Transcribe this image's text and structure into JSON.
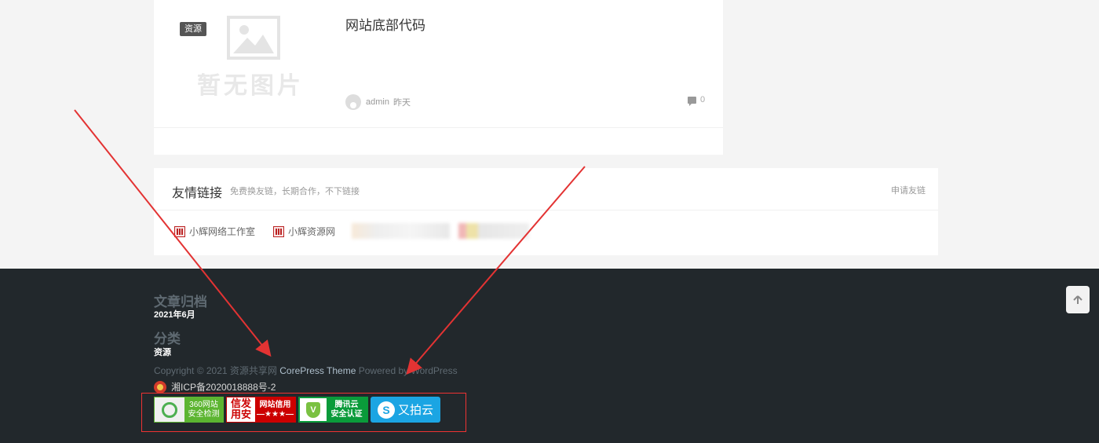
{
  "post": {
    "tag": "资源",
    "placeholder_text": "暂无图片",
    "title": "网站底部代码",
    "author": "admin",
    "time": "昨天",
    "comments": "0"
  },
  "links": {
    "title": "友情链接",
    "subtitle": "免费换友链，长期合作，不下链接",
    "apply": "申请友链",
    "items": [
      {
        "label": "小辉网络工作室"
      },
      {
        "label": "小辉资源网"
      }
    ]
  },
  "footer": {
    "archive_heading": "文章归档",
    "archive_item": "2021年6月",
    "category_heading": "分类",
    "category_item": "资源",
    "copyright_prefix": "Copyright © 2021 资源共享网",
    "theme": "CorePress Theme",
    "powered": "Powered by WordPress",
    "icp": "湘ICP备2020018888号-2",
    "badges": {
      "b360_line1": "360网站",
      "b360_line2": "安全检测",
      "credit_left_top": "信发",
      "credit_left_bottom": "用安",
      "credit_line1": "网站信用",
      "credit_line2": "—★★★—",
      "tencent_shield": "V",
      "tencent_line1": "腾讯云",
      "tencent_line2": "安全认证",
      "upyun_logo": "S",
      "upyun": "又拍云"
    }
  },
  "icons": {
    "to_top": "arrow-up-icon",
    "comment": "comment-icon",
    "placeholder": "image-placeholder-icon"
  },
  "colors": {
    "footer_bg": "#22282c",
    "annotation": "#e33333"
  }
}
